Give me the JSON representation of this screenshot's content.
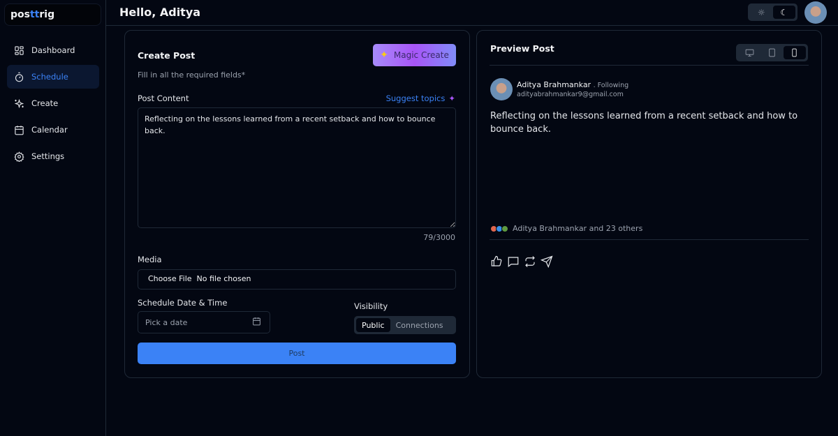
{
  "app": {
    "logo_pre": "pos",
    "logo_accent": "tt",
    "logo_post": "rig",
    "accent_color": "#3b82f6"
  },
  "sidebar": {
    "items": [
      {
        "label": "Dashboard",
        "icon": "dashboard-icon"
      },
      {
        "label": "Schedule",
        "icon": "timer-icon",
        "active": true
      },
      {
        "label": "Create",
        "icon": "sparkles-icon"
      },
      {
        "label": "Calendar",
        "icon": "calendar-icon"
      },
      {
        "label": "Settings",
        "icon": "gear-icon"
      }
    ]
  },
  "header": {
    "greeting": "Hello, Aditya",
    "theme": "dark"
  },
  "create": {
    "title": "Create Post",
    "magic_label": "Magic Create",
    "subtitle": "Fill in all the required fields*",
    "content_label": "Post Content",
    "suggest_label": "Suggest topics",
    "content": "Reflecting on the lessons learned from a recent setback and how to bounce back.",
    "count": "79/3000",
    "media_label": "Media",
    "choose_file": "Choose File",
    "no_file": "No file chosen",
    "schedule_label": "Schedule Date & Time",
    "date_placeholder": "Pick a date",
    "visibility_label": "Visibility",
    "visibility_options": [
      "Public",
      "Connections"
    ],
    "visibility_selected": "Public",
    "post_label": "Post"
  },
  "preview": {
    "title": "Preview Post",
    "device_selected": "mobile",
    "name": "Aditya Brahmankar",
    "following": ". Following",
    "email": "adityabrahmankar9@gmail.com",
    "text": "Reflecting on the lessons learned from a recent setback and how to bounce back.",
    "reactions": "Aditya Brahmankar and 23 others"
  }
}
